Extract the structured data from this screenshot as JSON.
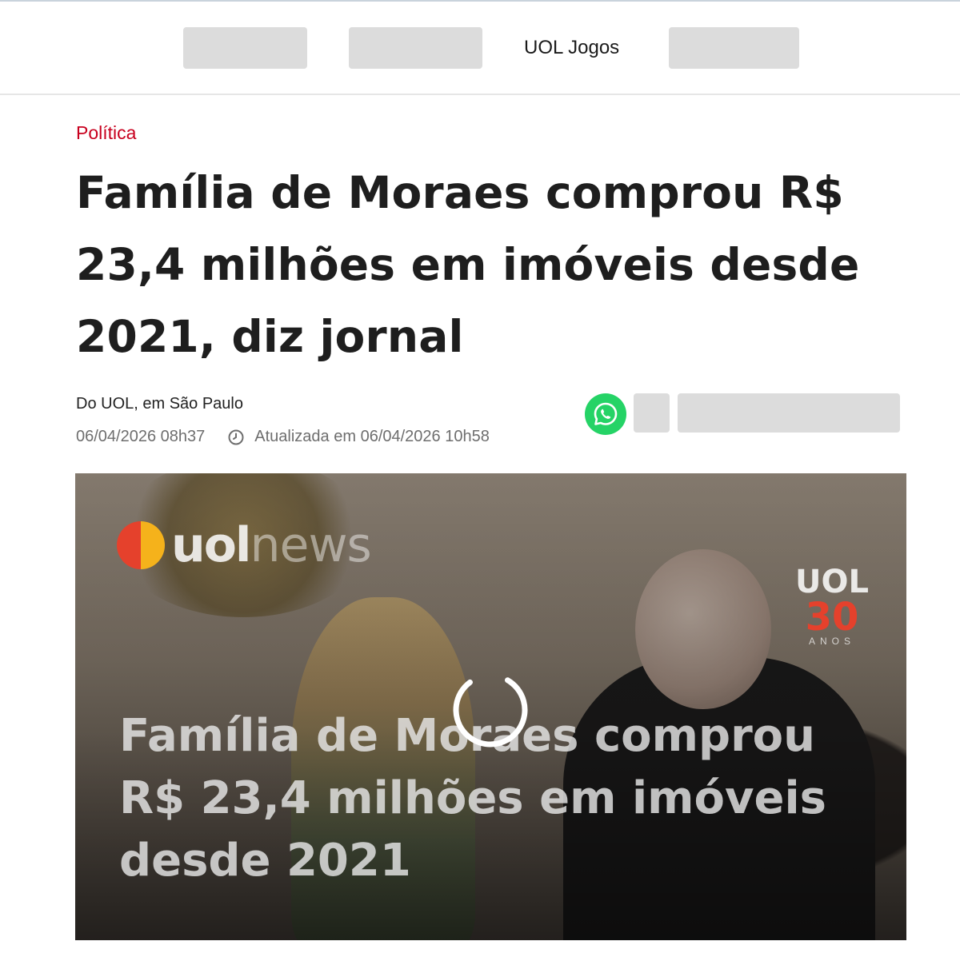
{
  "header": {
    "nav_items": [
      "",
      "",
      "UOL Jogos",
      ""
    ],
    "nav_label": "UOL Jogos"
  },
  "article": {
    "category": "Política",
    "headline": "Família de Moraes comprou R$ 23,4 milhões em imóveis desde 2021, diz jornal",
    "byline": "Do UOL, em São Paulo",
    "published": "06/04/2026 08h37",
    "updated": "Atualizada em 06/04/2026 10h58"
  },
  "share": {
    "icons": [
      "whatsapp-icon"
    ]
  },
  "video": {
    "logo_text": "uol",
    "logo_suffix": "news",
    "badge_top": "UOL",
    "badge_number": "30",
    "badge_bottom": "ANOS",
    "caption": "Família de Moraes comprou R$ 23,4 milhões em imóveis desde 2021",
    "state": "loading"
  },
  "colors": {
    "category": "#c8001e",
    "whatsapp": "#25d366",
    "placeholder": "#dcdcdc"
  }
}
